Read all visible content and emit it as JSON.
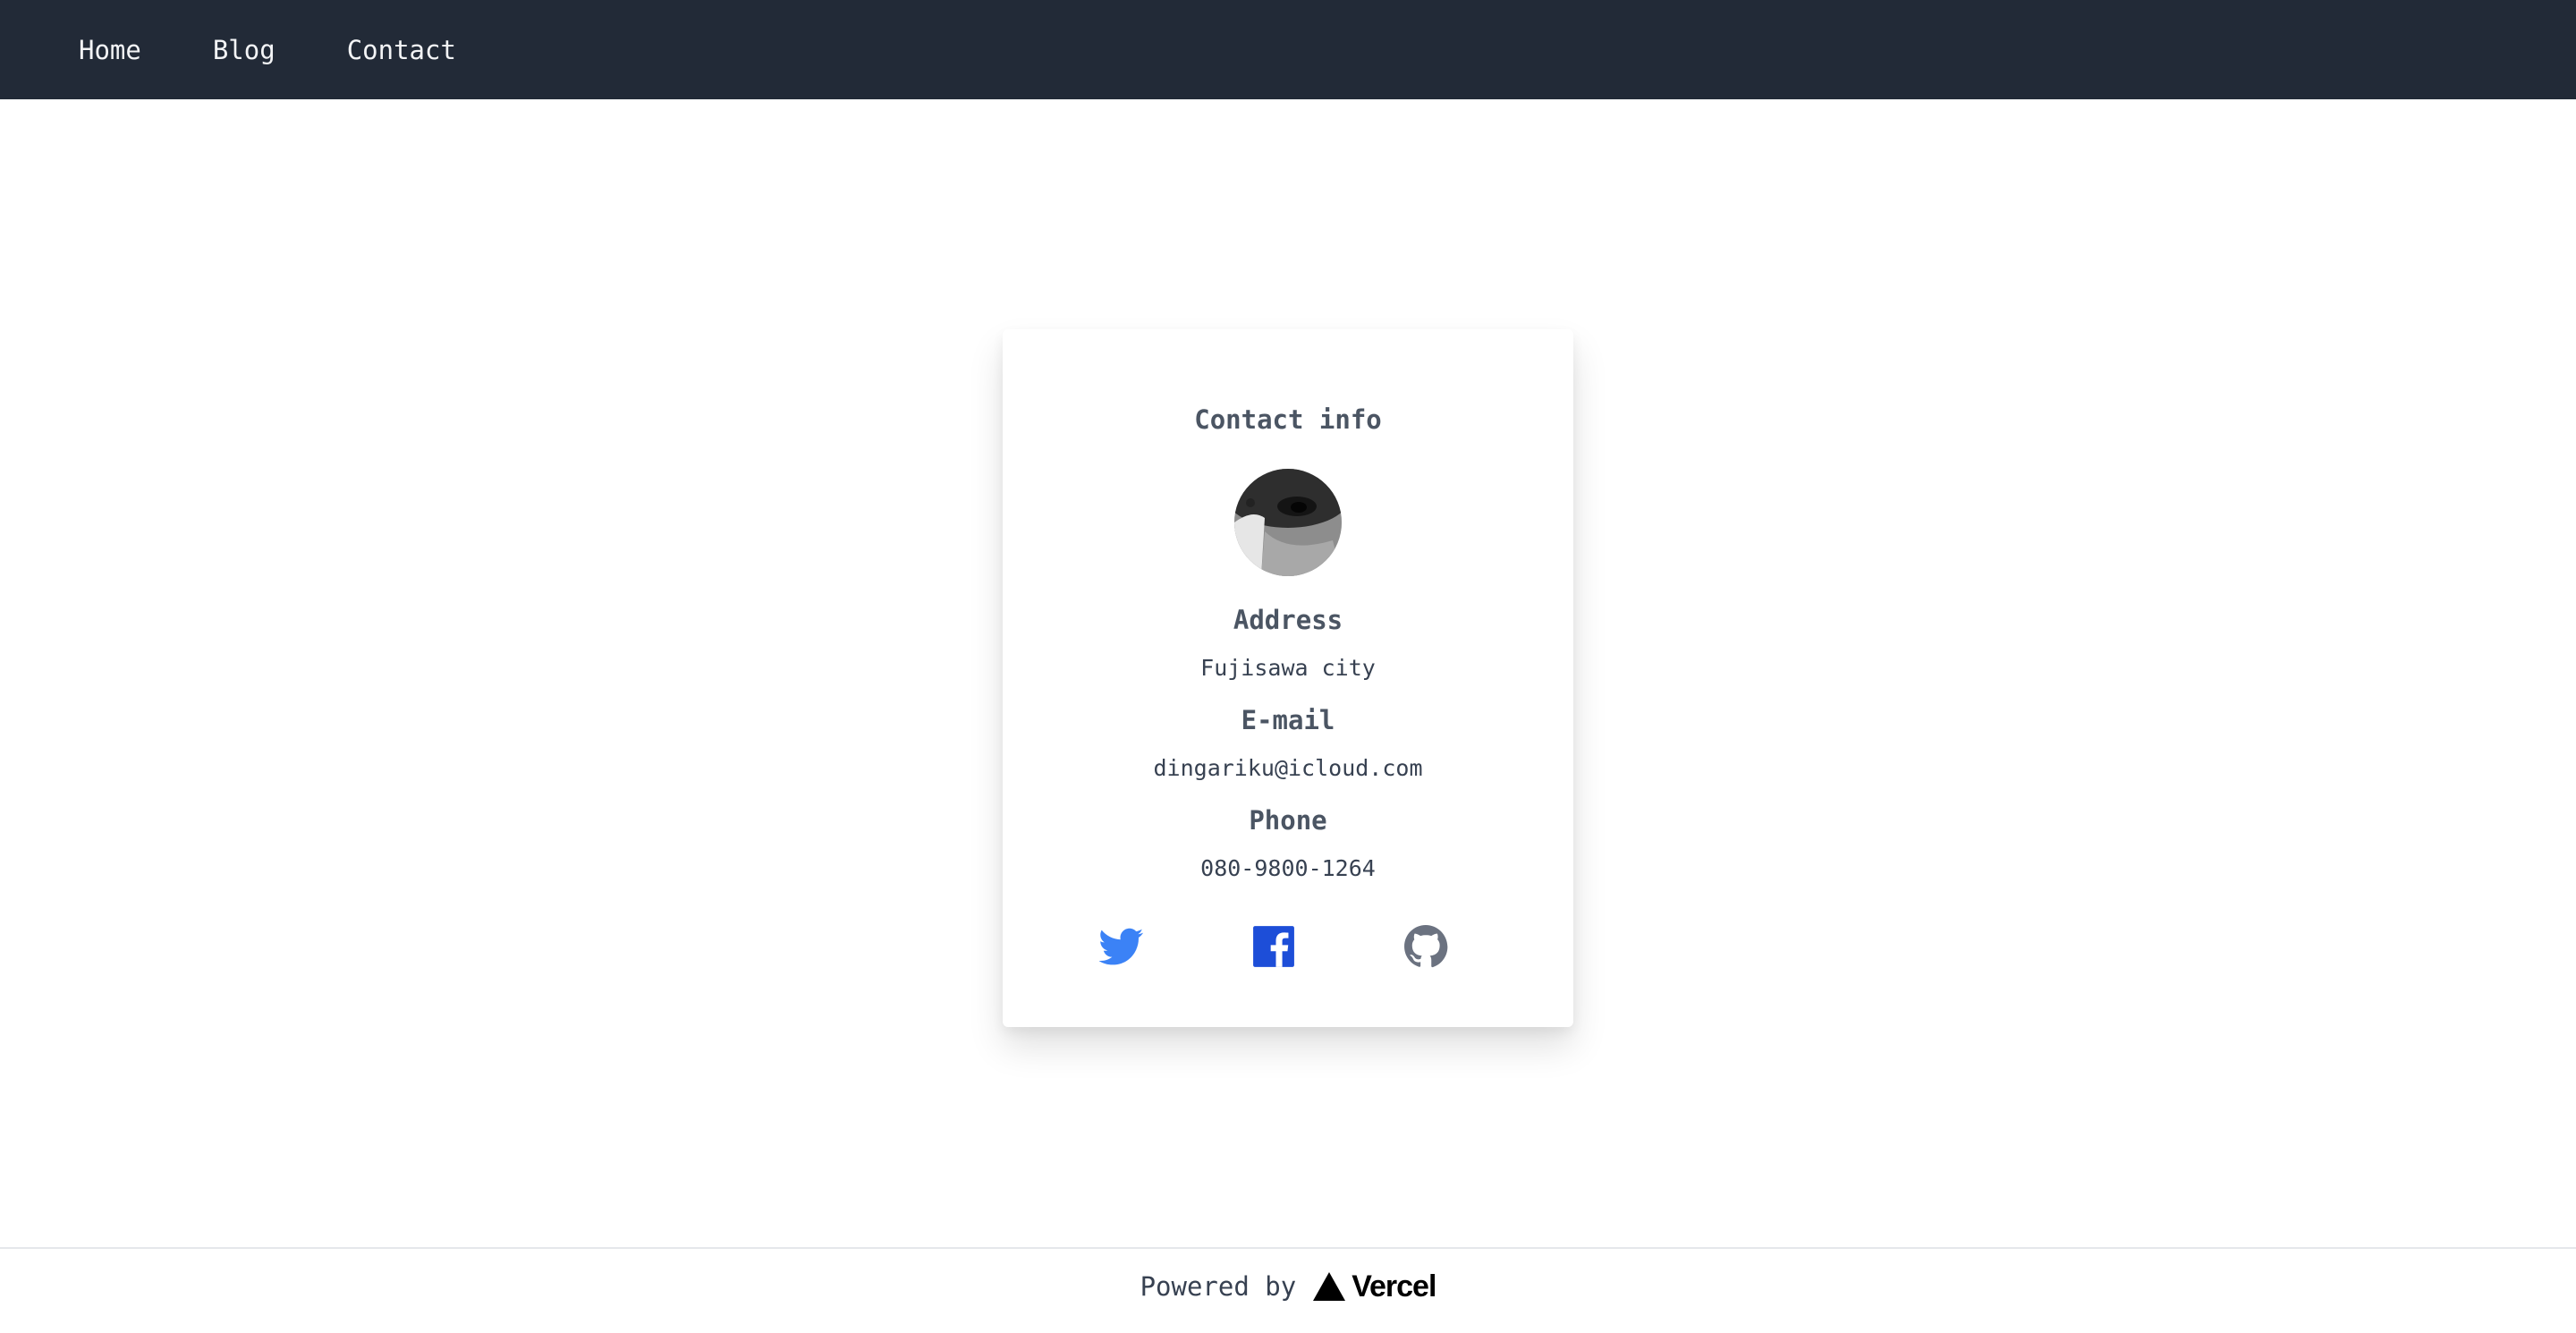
{
  "nav": {
    "items": [
      {
        "label": "Home"
      },
      {
        "label": "Blog"
      },
      {
        "label": "Contact"
      }
    ]
  },
  "card": {
    "title": "Contact info",
    "avatar_icon": "profile-photo",
    "address": {
      "label": "Address",
      "value": "Fujisawa city"
    },
    "email": {
      "label": "E-mail",
      "value": "dingariku@icloud.com"
    },
    "phone": {
      "label": "Phone",
      "value": "080-9800-1264"
    },
    "social": [
      {
        "icon": "twitter-icon",
        "color": "#3b82f6"
      },
      {
        "icon": "facebook-icon",
        "color": "#1d4ed8"
      },
      {
        "icon": "github-icon",
        "color": "#6b7280"
      }
    ]
  },
  "footer": {
    "powered_by": "Powered by",
    "logo_text": "Vercel"
  },
  "colors": {
    "navbar_bg": "#222a37",
    "nav_text": "#f3f4f6",
    "heading_text": "#4b5563"
  }
}
